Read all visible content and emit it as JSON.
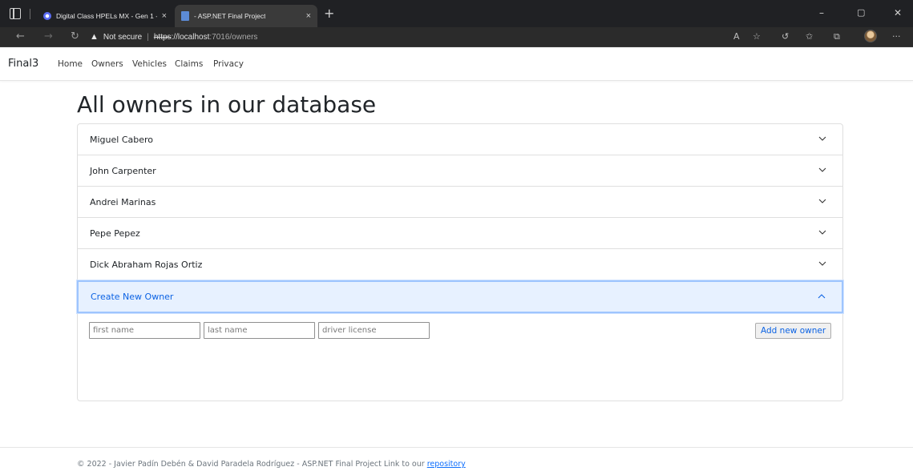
{
  "browser": {
    "tabs": [
      {
        "title": "Digital Class HPELs MX - Gen 1 -",
        "active": false
      },
      {
        "title": "- ASP.NET Final Project",
        "active": true
      }
    ],
    "address": {
      "security_label": "Not secure",
      "protocol": "https",
      "host": "://localhost",
      "path": ":7016/owners"
    }
  },
  "site": {
    "brand": "Final3",
    "nav": [
      "Home",
      "Owners",
      "Vehicles",
      "Claims",
      "Privacy"
    ]
  },
  "page": {
    "title": "All owners in our database"
  },
  "owners": [
    "Miguel Cabero",
    "John Carpenter",
    "Andrei Marinas",
    "Pepe Pepez",
    "Dick Abraham Rojas Ortiz"
  ],
  "create": {
    "header": "Create New Owner",
    "first_name_placeholder": "first name",
    "last_name_placeholder": "last name",
    "license_placeholder": "driver license",
    "submit_label": "Add new owner"
  },
  "footer": {
    "text": "© 2022 - Javier Padín Debén & David Paradela Rodríguez - ASP.NET Final Project Link to our",
    "link_label": "repository"
  },
  "colors": {
    "accent": "#0c63e4",
    "open_bg": "#e7f1ff"
  }
}
